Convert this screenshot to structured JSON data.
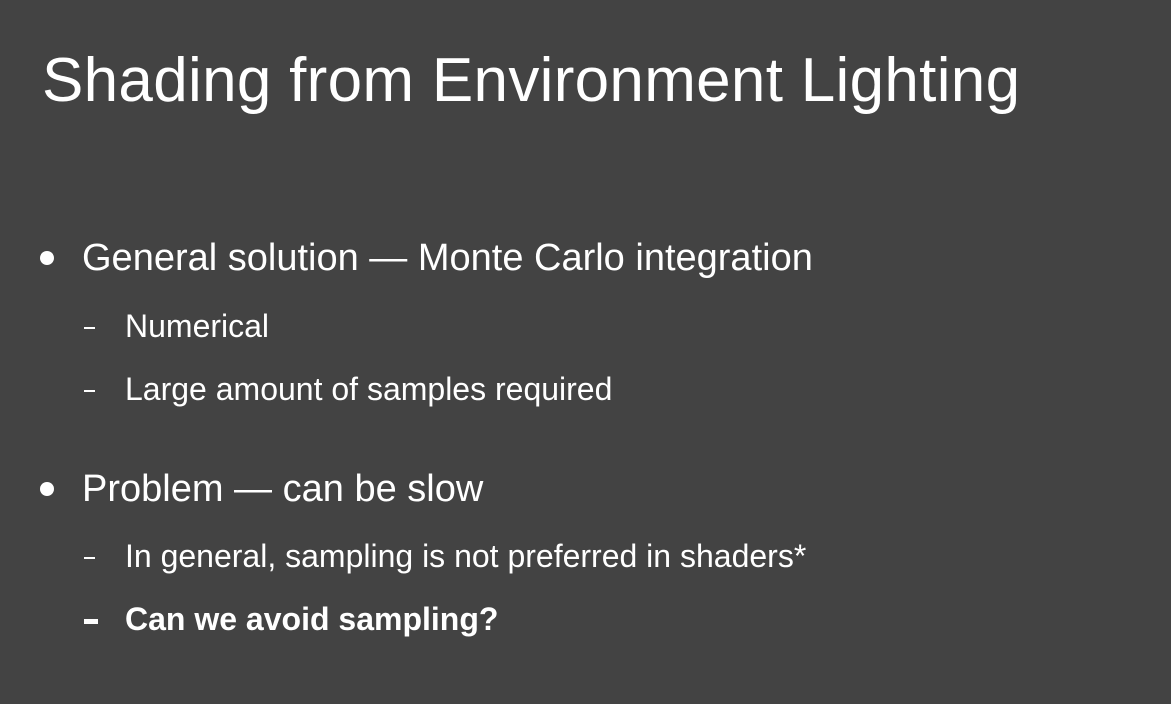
{
  "slide": {
    "title": "Shading from Environment Lighting",
    "bullets": [
      {
        "text": "General solution — Monte Carlo integration",
        "subitems": [
          {
            "text": "Numerical"
          },
          {
            "text": "Large amount of samples required"
          }
        ]
      },
      {
        "text": "Problem — can be slow",
        "subitems": [
          {
            "text": "In general, sampling is not preferred in shaders*"
          },
          {
            "text": "Can we avoid sampling?"
          }
        ]
      }
    ],
    "colors": {
      "background": "#434343",
      "text": "#ffffff"
    }
  }
}
